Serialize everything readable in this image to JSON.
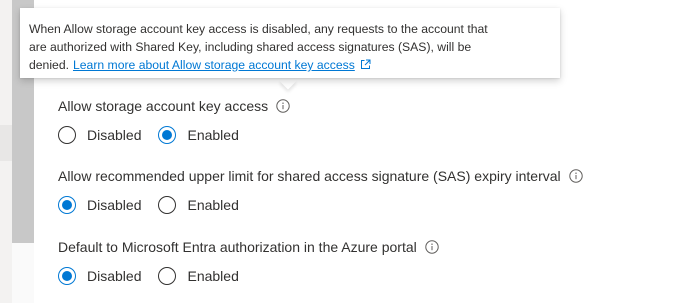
{
  "tooltip": {
    "line1": "When Allow storage account key access is disabled, any requests to the account that",
    "line2": "are authorized with Shared Key, including shared access signatures (SAS), will be",
    "line3": "denied.",
    "link_text": "Learn more about Allow storage account key access"
  },
  "settings": [
    {
      "label": "Allow storage account key access",
      "options": [
        {
          "label": "Disabled",
          "selected": false
        },
        {
          "label": "Enabled",
          "selected": true
        }
      ]
    },
    {
      "label": "Allow recommended upper limit for shared access signature (SAS) expiry interval",
      "options": [
        {
          "label": "Disabled",
          "selected": true
        },
        {
          "label": "Enabled",
          "selected": false
        }
      ]
    },
    {
      "label": "Default to Microsoft Entra authorization in the Azure portal",
      "options": [
        {
          "label": "Disabled",
          "selected": true
        },
        {
          "label": "Enabled",
          "selected": false
        }
      ]
    }
  ],
  "colors": {
    "accent": "#0078d4",
    "text": "#323130",
    "scrollbar_thumb": "#c8c8c8"
  },
  "icons": {
    "info": "info-icon",
    "external_link": "external-link-icon"
  }
}
